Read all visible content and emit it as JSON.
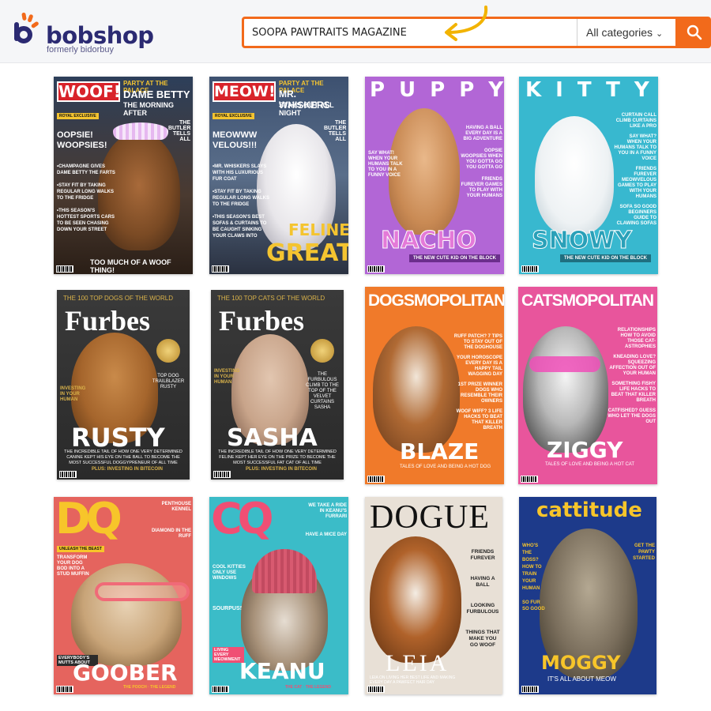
{
  "header": {
    "logo_word": "bobshop",
    "logo_tagline": "formerly bidorbuy",
    "search_value": "SOOPA PAWTRAITS MAGAZINE",
    "category": "All categories",
    "colors": {
      "accent": "#f26a1b",
      "brand": "#2b2a72"
    }
  },
  "covers": [
    {
      "masthead": "WOOF!",
      "kicker": "PARTY AT THE PALACE",
      "headline1": "DAME BETTY",
      "headline2": "THE MORNING AFTER",
      "badge": "ROYAL EXCLUSIVE",
      "side": "THE BUTLER TELLS ALL",
      "big": "OOPSIE! WOOPSIES!",
      "lines": [
        "•CHAMPAGNE GIVES DAME BETTY THE FARTS",
        "•STAY FIT BY TAKING REGULAR LONG WALKS TO THE FRIDGE",
        "•THIS SEASON'S HOTTEST SPORTS CARS TO BE SEEN CHASING DOWN YOUR STREET"
      ],
      "footer": "TOO MUCH OF A WOOF THING!"
    },
    {
      "masthead": "MEOW!",
      "kicker": "PARTY AT THE PALACE",
      "headline1": "MR. WHISKERS",
      "headline2": "STAYS OUT ALL NIGHT",
      "badge": "ROYAL EXCLUSIVE",
      "side": "THE BUTLER TELLS ALL",
      "big": "MEOWWW VELOUS!!!",
      "lines": [
        "•MR. WHISKERS SLAYS WITH HIS LUXURIOUS FUR COAT",
        "•STAY FIT BY TAKING REGULAR LONG WALKS TO THE FRIDGE",
        "•THIS SEASON'S BEST SOFAS & CURTAINS TO BE CAUGHT SINKING YOUR CLAWS INTO"
      ],
      "footer1": "FELINE",
      "footer2": "GREAT"
    },
    {
      "masthead": "PUPPY",
      "lines": [
        "HAVING A BALL EVERY DAY IS A BIG ADVENTURE",
        "OOPSIE WOOPSIES WHEN YOU GOTTA GO YOU GOTTA GO",
        "FRIENDS FUREVER GAMES TO PLAY WITH YOUR HUMANS"
      ],
      "left": "SAY WHAT! WHEN YOUR HUMANS TALK TO YOU IN A FUNNY VOICE",
      "name": "NACHO",
      "ribbon": "THE NEW CUTE KID ON THE BLOCK"
    },
    {
      "masthead": "KITTY",
      "lines": [
        "CURTAIN CALL CLIMB CURTAINS LIKE A PRO",
        "SAY WHAT? WHEN YOUR HUMANS TALK TO YOU IN A FUNNY VOICE",
        "FRIENDS FUREVER MEOWVELOUS GAMES TO PLAY WITH YOUR HUMANS",
        "SOFA SO GOOD BEGINNERS GUIDE TO CLAWING SOFAS"
      ],
      "name": "SNOWY",
      "ribbon": "THE NEW CUTE KID ON THE BLOCK"
    },
    {
      "kicker": "THE 100 TOP DOGS OF THE WORLD",
      "masthead": "Furbes",
      "side": "TOP DOG TRAILBLAZER RUSTY",
      "left": "INVESTING IN YOUR HUMAN",
      "name": "RUSTY",
      "story": "THE INCREDIBLE TAIL OF HOW ONE VERY DETERMINED CANINE KEPT HIS EYE ON THE BALL TO BECOME THE MOST SUCCESSFUL DOGGYPRENEUR OF ALL TIME",
      "plus": "PLUS: INVESTING IN BITECOIN"
    },
    {
      "kicker": "THE 100 TOP CATS OF THE WORLD",
      "masthead": "Furbes",
      "side": "THE FURBULOUS CLIMB TO THE TOP OF THE VELVET CURTAINS SASHA",
      "left": "INVESTING IN YOUR HUMAN",
      "name": "SASHA",
      "story": "THE INCREDIBLE TAIL OF HOW ONE VERY DETERMINED FELINE KEPT HER EYE ON THE PRIZE TO BECOME THE MOST SUCCESSFUL FAT CAT OF ALL TIME",
      "plus": "PLUS: INVESTING IN BITECOIN"
    },
    {
      "masthead": "DOGSMOPOLITAN",
      "lines": [
        "RUFF PATCH? 7 TIPS TO STAY OUT OF THE DOGHOUSE",
        "YOUR HOROSCOPE EVERY DAY IS A HAPPY TAIL WAGGING DAY",
        "1ST PRIZE WINNER DOGS WHO RESEMBLE THEIR OWNERS",
        "WOOF WIFF? 3 LIFE HACKS TO BEAT THAT KILLER BREATH"
      ],
      "name": "BLAZE",
      "ribbon": "TALES OF LOVE AND BEING A HOT DOG"
    },
    {
      "masthead": "CATSMOPOLITAN",
      "lines": [
        "RELATIONSHIPS HOW TO AVOID THOSE CAT-ASTROPHIES",
        "KNEADING LOVE? SQUEEZING AFFECTION OUT OF YOUR HUMAN",
        "SOMETHING FISHY LIFE HACKS TO BEAT THAT KILLER BREATH",
        "CATFISHED? GUESS WHO LET THE DOGS OUT"
      ],
      "name": "ZIGGY",
      "ribbon": "TALES OF LOVE AND BEING A HOT CAT"
    },
    {
      "masthead": "DQ",
      "tags": [
        "PENTHOUSE KENNEL",
        "DIAMOND IN THE RUFF",
        "UNLEASH THE BEAST"
      ],
      "left": "TRANSFORM YOUR DOG BOD INTO A STUD MUFFIN",
      "name": "GOOBER",
      "ribbon": "THE POOCH · THE LEGEND",
      "bottom_tag": "EVERYBODY'S MUTTS ABOUT"
    },
    {
      "masthead": "CQ",
      "tags": [
        "WE TAKE A RIDE IN KEANU'S FURRARI",
        "HAVE A MICE DAY",
        "COOL KITTIES ONLY USE WINDOWS",
        "SOURPUSS"
      ],
      "name": "KEANU",
      "ribbon": "THE CAT · THE LEGEND",
      "bottom_tag": "LIVING EVERY MEOWMENT"
    },
    {
      "masthead": "DOGUE",
      "lines": [
        "FRIENDS FUREVER",
        "HAVING A BALL",
        "LOOKING FURBULOUS",
        "THINGS THAT MAKE YOU GO WOOF"
      ],
      "name": "LEIA",
      "story": "LEIA ON LIVING HER BEST LIFE AND MAKING EVERY DAY A PAWFECT HAIR DAY"
    },
    {
      "masthead": "cattitude",
      "left": "WHO'S THE BOSS? HOW TO TRAIN YOUR HUMAN",
      "right": "GET THE PAWTY STARTED",
      "name": "MOGGY",
      "ribbon": "IT'S ALL ABOUT MEOW",
      "left2": "SO FUR SO GOOD"
    }
  ]
}
